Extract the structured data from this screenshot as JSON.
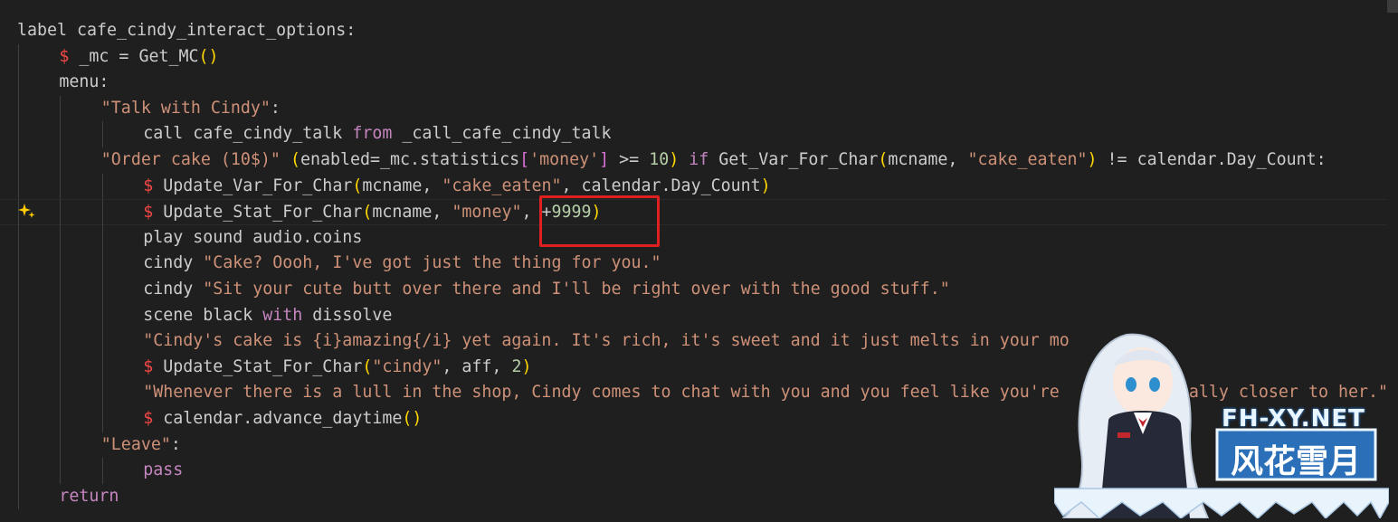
{
  "editor": {
    "lines": [
      {
        "indent": 0,
        "tokens": [
          {
            "t": "label cafe_cindy_interact_options:",
            "c": ""
          }
        ]
      },
      {
        "indent": 1,
        "tokens": [
          {
            "t": "$",
            "c": "dl"
          },
          {
            "t": " _mc = Get_MC",
            "c": ""
          },
          {
            "t": "()",
            "c": "b"
          }
        ]
      },
      {
        "indent": 1,
        "tokens": [
          {
            "t": "menu:",
            "c": ""
          }
        ]
      },
      {
        "indent": 2,
        "tokens": [
          {
            "t": "\"Talk with Cindy\"",
            "c": "s"
          },
          {
            "t": ":",
            "c": ""
          }
        ]
      },
      {
        "indent": 3,
        "tokens": [
          {
            "t": "call cafe_cindy_talk ",
            "c": ""
          },
          {
            "t": "from",
            "c": "k"
          },
          {
            "t": " _call_cafe_cindy_talk",
            "c": ""
          }
        ]
      },
      {
        "indent": 2,
        "tokens": [
          {
            "t": "\"Order cake (10$)\"",
            "c": "s"
          },
          {
            "t": " ",
            "c": ""
          },
          {
            "t": "(",
            "c": "b"
          },
          {
            "t": "enabled=_mc.statistics",
            "c": ""
          },
          {
            "t": "[",
            "c": "b2"
          },
          {
            "t": "'money'",
            "c": "s"
          },
          {
            "t": "]",
            "c": "b2"
          },
          {
            "t": " >= ",
            "c": ""
          },
          {
            "t": "10",
            "c": "n"
          },
          {
            "t": ")",
            "c": "b"
          },
          {
            "t": " ",
            "c": ""
          },
          {
            "t": "if",
            "c": "k"
          },
          {
            "t": " Get_Var_For_Char",
            "c": ""
          },
          {
            "t": "(",
            "c": "b"
          },
          {
            "t": "mcname, ",
            "c": ""
          },
          {
            "t": "\"cake_eaten\"",
            "c": "s"
          },
          {
            "t": ")",
            "c": "b"
          },
          {
            "t": " != calendar.Day_Count:",
            "c": ""
          }
        ]
      },
      {
        "indent": 3,
        "tokens": [
          {
            "t": "$",
            "c": "dl"
          },
          {
            "t": " Update_Var_For_Char",
            "c": ""
          },
          {
            "t": "(",
            "c": "b"
          },
          {
            "t": "mcname, ",
            "c": ""
          },
          {
            "t": "\"cake_eaten\"",
            "c": "s"
          },
          {
            "t": ", calendar.Day_Count",
            "c": ""
          },
          {
            "t": ")",
            "c": "b"
          }
        ]
      },
      {
        "indent": 3,
        "tokens": [
          {
            "t": "$",
            "c": "dl"
          },
          {
            "t": " Update_Stat_For_Char",
            "c": ""
          },
          {
            "t": "(",
            "c": "b"
          },
          {
            "t": "mcname, ",
            "c": ""
          },
          {
            "t": "\"money\"",
            "c": "s"
          },
          {
            "t": ", +",
            "c": ""
          },
          {
            "t": "9999",
            "c": "n"
          },
          {
            "t": ")",
            "c": "b"
          }
        ]
      },
      {
        "indent": 3,
        "tokens": [
          {
            "t": "play sound audio.coins",
            "c": ""
          }
        ]
      },
      {
        "indent": 3,
        "tokens": [
          {
            "t": "cindy ",
            "c": ""
          },
          {
            "t": "\"Cake? Oooh, I've got just the thing for you.\"",
            "c": "s"
          }
        ]
      },
      {
        "indent": 3,
        "tokens": [
          {
            "t": "cindy ",
            "c": ""
          },
          {
            "t": "\"Sit your cute butt over there and I'll be right over with the good stuff.\"",
            "c": "s"
          }
        ]
      },
      {
        "indent": 3,
        "tokens": [
          {
            "t": "scene black ",
            "c": ""
          },
          {
            "t": "with",
            "c": "k"
          },
          {
            "t": " dissolve",
            "c": ""
          }
        ]
      },
      {
        "indent": 3,
        "tokens": [
          {
            "t": "\"Cindy's cake is {i}amazing{/i} yet again. It's rich, it's sweet and it just melts in your mo",
            "c": "s"
          }
        ]
      },
      {
        "indent": 3,
        "tokens": [
          {
            "t": "$",
            "c": "dl"
          },
          {
            "t": " Update_Stat_For_Char",
            "c": ""
          },
          {
            "t": "(",
            "c": "b"
          },
          {
            "t": "\"cindy\"",
            "c": "s"
          },
          {
            "t": ", aff, ",
            "c": ""
          },
          {
            "t": "2",
            "c": "n"
          },
          {
            "t": ")",
            "c": "b"
          }
        ]
      },
      {
        "indent": 3,
        "tokens": [
          {
            "t": "\"Whenever there is a lull in the shop, Cindy comes to chat with you and you feel like you're ",
            "c": "s"
          },
          {
            "t": "           ",
            "c": ""
          },
          {
            "t": "nally closer to her.\"",
            "c": "s"
          }
        ]
      },
      {
        "indent": 3,
        "tokens": [
          {
            "t": "$",
            "c": "dl"
          },
          {
            "t": " calendar.advance_daytime",
            "c": ""
          },
          {
            "t": "()",
            "c": "b"
          }
        ]
      },
      {
        "indent": 2,
        "tokens": [
          {
            "t": "\"Leave\"",
            "c": "s"
          },
          {
            "t": ":",
            "c": ""
          }
        ]
      },
      {
        "indent": 3,
        "tokens": [
          {
            "t": "pass",
            "c": "k"
          }
        ]
      },
      {
        "indent": 1,
        "tokens": [
          {
            "t": "return",
            "c": "k"
          }
        ]
      }
    ],
    "current_line": 7
  },
  "watermark": {
    "domain": "FH-XY.NET",
    "name": "风花雪月"
  },
  "icons": {
    "lightbulb": "sparkle-lightbulb-icon"
  },
  "colors": {
    "background": "#1f1f1f",
    "text": "#cccccc",
    "keyword": "#c586c0",
    "string": "#ce9178",
    "number": "#b5cea8",
    "dollar": "#f44747",
    "bracket": "#ffd700",
    "highlight_box": "#e02020"
  }
}
